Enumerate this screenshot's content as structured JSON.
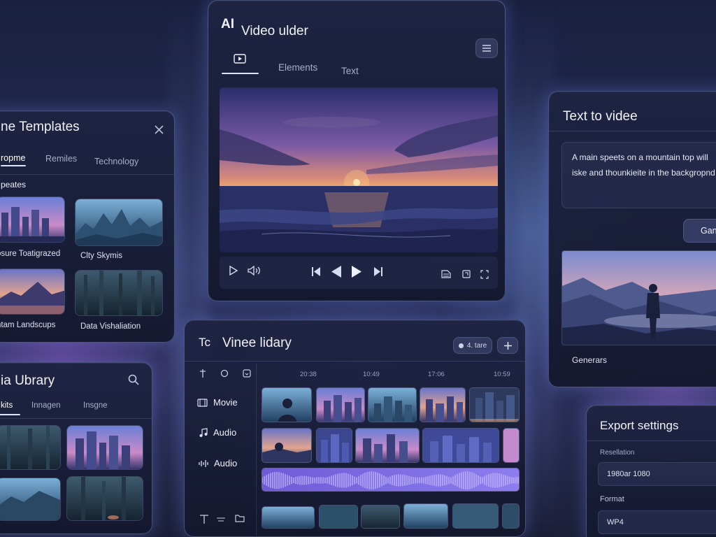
{
  "colors": {
    "accent": "#8a7dff",
    "panel": "#1c2140",
    "glow": "#9fb0ff"
  },
  "video_builder": {
    "brand": "AI",
    "title": "Video ulder",
    "menu_icon": "hamburger-icon",
    "tabs": [
      {
        "label": "",
        "icon": "video-icon",
        "active": true
      },
      {
        "label": "Elements",
        "active": false
      },
      {
        "label": "Text",
        "active": false
      }
    ],
    "controls": [
      "play-icon",
      "volume-icon",
      "skip-back-icon",
      "rewind-icon",
      "play-icon",
      "skip-forward-icon",
      "caption-icon",
      "crop-icon",
      "fullscreen-icon"
    ]
  },
  "templates": {
    "title": "ne Templates",
    "tabs": [
      "ropme",
      "Remiles",
      "Technology"
    ],
    "section_label": "peates",
    "items": [
      {
        "caption": "osure Toatigrazed"
      },
      {
        "caption": "Clty Skymis"
      },
      {
        "caption": "ntam Landscups"
      },
      {
        "caption": "Data Vishaliation"
      }
    ]
  },
  "text_to_video": {
    "title": "Text to videe",
    "prompt": "A main speets on a mountain top will iske and thounkieite in the backgropnd",
    "prompt_line1": "A main speets on a mountain top will",
    "prompt_line2": "iske and thounkieite in the backgropnd",
    "generate_button": "Gan",
    "result_label": "Generars"
  },
  "timeline": {
    "icon": "Tc",
    "title": "Vinee lidary",
    "badge": "4. tare",
    "add_icon": "plus-icon",
    "tools": [
      "cut-icon",
      "loop-icon",
      "export-icon"
    ],
    "timecodes": [
      "20:38",
      "10:49",
      "17:06",
      "10:59"
    ],
    "tracks": [
      {
        "label": "Movie",
        "icon": "film-icon"
      },
      {
        "label": "Audio",
        "icon": "music-note-icon"
      },
      {
        "label": "Audio",
        "icon": "audio-bars-icon"
      }
    ],
    "bottom_tools": [
      "text-tool-icon",
      "minus-icon",
      "folder-icon"
    ]
  },
  "media_library": {
    "title": "ia Ubrary",
    "search_icon": "search-icon",
    "tabs": [
      "kits",
      "Innagen",
      "Insgne"
    ]
  },
  "export": {
    "title": "Export settings",
    "resolution_label": "Resellation",
    "resolution_value": "1980ar 1080",
    "format_label": "Format",
    "format_value": "WP4"
  }
}
